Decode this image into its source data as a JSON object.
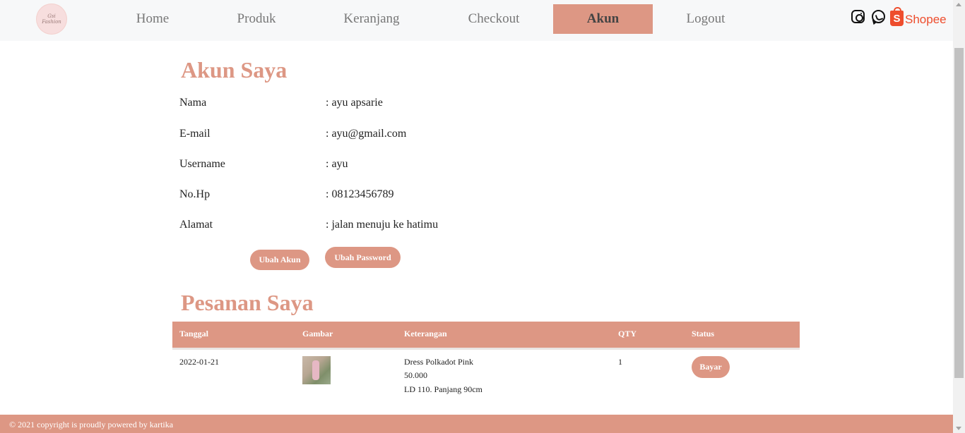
{
  "brand": {
    "logo_line1": "Gsi",
    "logo_line2": "Fashion"
  },
  "nav": {
    "items": [
      {
        "label": "Home"
      },
      {
        "label": "Produk"
      },
      {
        "label": "Keranjang"
      },
      {
        "label": "Checkout"
      },
      {
        "label": "Akun",
        "active": true
      },
      {
        "label": "Logout"
      }
    ],
    "social": [
      "instagram-icon",
      "whatsapp-icon",
      "shopee-icon"
    ],
    "shopee_label": "Shopee",
    "shopee_bag_letter": "S"
  },
  "account": {
    "title": "Akun Saya",
    "fields": [
      {
        "label": "Nama",
        "value": ": ayu apsarie"
      },
      {
        "label": "E-mail",
        "value": ": ayu@gmail.com"
      },
      {
        "label": "Username",
        "value": ": ayu"
      },
      {
        "label": "No.Hp",
        "value": ": 08123456789"
      },
      {
        "label": "Alamat",
        "value": ": jalan menuju ke hatimu"
      }
    ],
    "edit_button": "Ubah Akun",
    "password_button": "Ubah Password"
  },
  "orders": {
    "title": "Pesanan Saya",
    "columns": [
      "Tanggal",
      "Gambar",
      "Keterangan",
      "QTY",
      "Status"
    ],
    "rows": [
      {
        "date": "2022-01-21",
        "product_name": "Dress Polkadot Pink",
        "price": "50.000",
        "description": "LD 110. Panjang 90cm",
        "qty": "1",
        "status_button": "Bayar"
      }
    ]
  },
  "footer": {
    "text": "© 2021 copyright is proudly powered by kartika"
  },
  "colors": {
    "accent": "#dd9784",
    "nav_bg": "#f7f8f9",
    "shopee": "#ee4d2d"
  }
}
